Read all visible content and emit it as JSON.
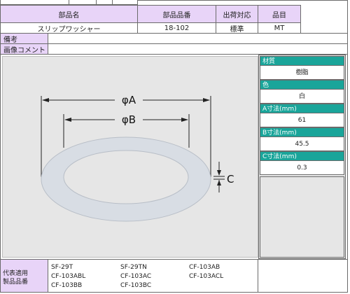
{
  "header": {
    "col_part_name": "部品名",
    "col_part_no": "部品品番",
    "col_shipping": "出荷対応",
    "col_category": "品目"
  },
  "row": {
    "part_name": "スリップワッシャー",
    "part_no": "18-102",
    "shipping": "標準",
    "category": "MT"
  },
  "notes_label": "備考",
  "image_comment_label": "画像コメント",
  "drawing": {
    "label_a": "φA",
    "label_b": "φB",
    "label_c": "C"
  },
  "properties": [
    {
      "name": "材質",
      "value": "樹脂"
    },
    {
      "name": "色",
      "value": "白"
    },
    {
      "name": "A寸法(mm)",
      "value": "61"
    },
    {
      "name": "B寸法(mm)",
      "value": "45.5"
    },
    {
      "name": "C寸法(mm)",
      "value": "0.3"
    }
  ],
  "related": {
    "label_line1": "代表適用",
    "label_line2": "製品品番",
    "items": [
      "SF-29T",
      "SF-29TN",
      "CF-103AB",
      "CF-103ABL",
      "CF-103AC",
      "CF-103ACL",
      "CF-103BB",
      "CF-103BC"
    ]
  },
  "colors": {
    "header_bg": "#e8d4f8",
    "property_header_bg": "#1aa59a",
    "drawing_bg": "#e6e6e6",
    "washer_fill": "#d8dde4"
  }
}
